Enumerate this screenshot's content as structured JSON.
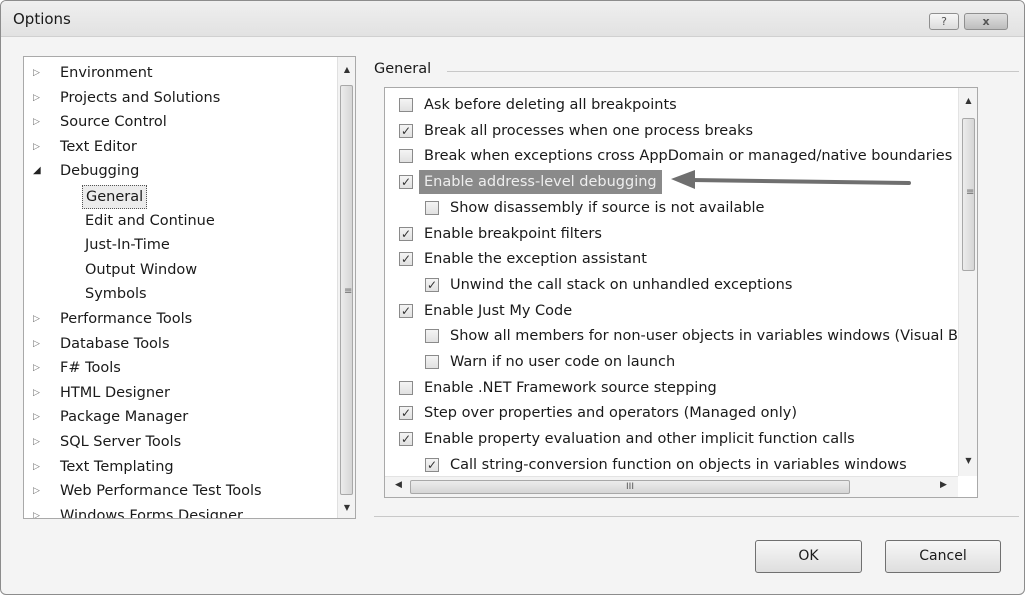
{
  "window": {
    "title": "Options",
    "help_glyph": "?",
    "close_glyph": "x"
  },
  "tree": {
    "items": [
      {
        "label": "Environment",
        "expander": "▷",
        "level": 0
      },
      {
        "label": "Projects and Solutions",
        "expander": "▷",
        "level": 0
      },
      {
        "label": "Source Control",
        "expander": "▷",
        "level": 0
      },
      {
        "label": "Text Editor",
        "expander": "▷",
        "level": 0
      },
      {
        "label": "Debugging",
        "expander": "◢",
        "level": 0
      },
      {
        "label": "General",
        "expander": "",
        "level": 1,
        "selected": true
      },
      {
        "label": "Edit and Continue",
        "expander": "",
        "level": 1
      },
      {
        "label": "Just-In-Time",
        "expander": "",
        "level": 1
      },
      {
        "label": "Output Window",
        "expander": "",
        "level": 1
      },
      {
        "label": "Symbols",
        "expander": "",
        "level": 1
      },
      {
        "label": "Performance Tools",
        "expander": "▷",
        "level": 0
      },
      {
        "label": "Database Tools",
        "expander": "▷",
        "level": 0
      },
      {
        "label": "F# Tools",
        "expander": "▷",
        "level": 0
      },
      {
        "label": "HTML Designer",
        "expander": "▷",
        "level": 0
      },
      {
        "label": "Package Manager",
        "expander": "▷",
        "level": 0
      },
      {
        "label": "SQL Server Tools",
        "expander": "▷",
        "level": 0
      },
      {
        "label": "Text Templating",
        "expander": "▷",
        "level": 0
      },
      {
        "label": "Web Performance Test Tools",
        "expander": "▷",
        "level": 0
      },
      {
        "label": "Windows Forms Designer",
        "expander": "▷",
        "level": 0
      }
    ]
  },
  "general": {
    "group_label": "General",
    "options": [
      {
        "label": "Ask before deleting all breakpoints",
        "checked": false,
        "indent": 0
      },
      {
        "label": "Break all processes when one process breaks",
        "checked": true,
        "indent": 0
      },
      {
        "label": "Break when exceptions cross AppDomain or managed/native boundaries (M",
        "checked": false,
        "indent": 0
      },
      {
        "label": "Enable address-level debugging",
        "checked": true,
        "indent": 0,
        "highlighted": true
      },
      {
        "label": "Show disassembly if source is not available",
        "checked": false,
        "indent": 1
      },
      {
        "label": "Enable breakpoint filters",
        "checked": true,
        "indent": 0
      },
      {
        "label": "Enable the exception assistant",
        "checked": true,
        "indent": 0
      },
      {
        "label": "Unwind the call stack on unhandled exceptions",
        "checked": true,
        "indent": 1
      },
      {
        "label": "Enable Just My Code",
        "checked": true,
        "indent": 0
      },
      {
        "label": "Show all members for non-user objects in variables windows (Visual Ba",
        "checked": false,
        "indent": 1
      },
      {
        "label": "Warn if no user code on launch",
        "checked": false,
        "indent": 1
      },
      {
        "label": "Enable .NET Framework source stepping",
        "checked": false,
        "indent": 0
      },
      {
        "label": "Step over properties and operators (Managed only)",
        "checked": true,
        "indent": 0
      },
      {
        "label": "Enable property evaluation and other implicit function calls",
        "checked": true,
        "indent": 0
      },
      {
        "label": "Call string-conversion function on objects in variables windows",
        "checked": true,
        "indent": 1
      }
    ],
    "hscroll_grip": "III"
  },
  "buttons": {
    "ok": "OK",
    "cancel": "Cancel"
  },
  "colors": {
    "highlight_bg": "#8a8a8a",
    "arrow": "#6f6f6f"
  }
}
